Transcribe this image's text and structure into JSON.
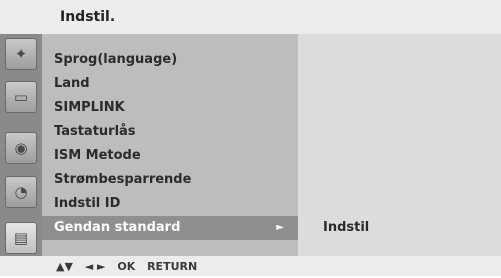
{
  "header": {
    "title": "Indstil."
  },
  "sidebar": {
    "icons": [
      {
        "icon": "satellite-dish-icon",
        "glyph": "✦"
      },
      {
        "icon": "monitor-icon",
        "glyph": "▭"
      },
      {
        "icon": "speaker-icon",
        "glyph": "◉"
      },
      {
        "icon": "clock-icon",
        "glyph": "◔"
      },
      {
        "icon": "setup-icon",
        "glyph": "▤"
      }
    ]
  },
  "menu": {
    "items": [
      {
        "label": "Sprog(language)"
      },
      {
        "label": "Land"
      },
      {
        "label": "SIMPLINK"
      },
      {
        "label": "Tastaturlås"
      },
      {
        "label": "ISM Metode"
      },
      {
        "label": "Strømbesparrende"
      },
      {
        "label": "Indstil ID"
      },
      {
        "label": "Gendan standard",
        "arrow": "►"
      }
    ],
    "selected_index": 7
  },
  "submenu": {
    "item": "Indstil"
  },
  "footer": {
    "updown": "▲▼",
    "leftright": "◄ ►",
    "ok": "OK",
    "return": "RETURN"
  }
}
